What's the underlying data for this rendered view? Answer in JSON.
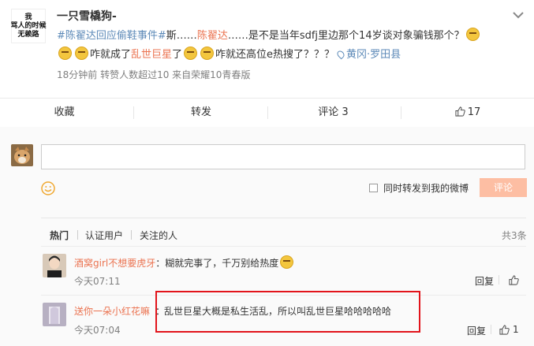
{
  "post": {
    "avatar_text": [
      "我",
      "骂人的时候",
      "无赖路"
    ],
    "username": "一只雪橇狗-",
    "content": {
      "seg1": "#陈翟达回应偷鞋事件#",
      "seg2": "斯……",
      "seg3": "陈翟达",
      "seg4": "……是不是当年sdfj里边那个14岁谈对象骗钱那个？",
      "seg5": "咋就成了",
      "seg6": "乱世巨星",
      "seg7": "了",
      "seg8": "咋就还高位e热搜了？？？",
      "location": "黄冈·罗田县"
    },
    "meta": "18分钟前 转赞人数超过10  来自荣耀10青春版"
  },
  "actions": {
    "collect": "收藏",
    "repost": "转发",
    "comment": "评论 3",
    "like": "17"
  },
  "composer": {
    "repost_label": "同时转发到我的微博",
    "submit": "评论"
  },
  "tabs": {
    "hot": "热门",
    "verified": "认证用户",
    "following": "关注的人",
    "total": "共3条"
  },
  "comments": [
    {
      "name": "酒窝girl不想要虎牙",
      "text": "：糊就完事了，千万别给热度",
      "time": "今天07:11",
      "reply": "回复",
      "likes": ""
    },
    {
      "name": "送你一朵小红花嘛",
      "text": "：",
      "highlight": "乱世巨星大概是私生活乱，所以叫乱世巨星哈哈哈哈哈",
      "time": "今天07:04",
      "reply": "回复",
      "likes": "1"
    }
  ],
  "colors": {
    "accent": "#eb7350",
    "link": "#5d8ab8",
    "button_disabled": "#fdbea3",
    "highlight_box": "#e2141b"
  }
}
